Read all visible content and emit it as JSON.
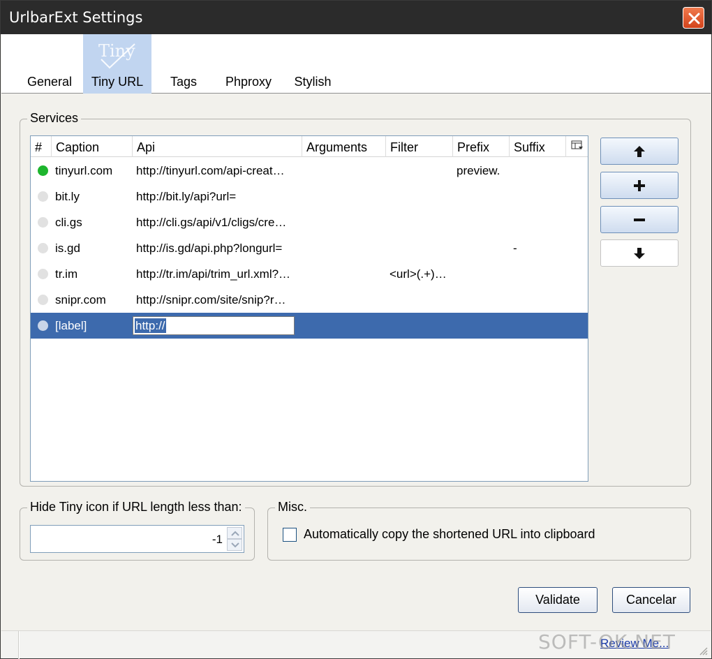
{
  "window": {
    "title": "UrlbarExt Settings"
  },
  "tabs": [
    {
      "label": "General",
      "selected": false
    },
    {
      "label": "Tiny URL",
      "selected": true
    },
    {
      "label": "Tags",
      "selected": false
    },
    {
      "label": "Phproxy",
      "selected": false
    },
    {
      "label": "Stylish",
      "selected": false
    }
  ],
  "tiny_logo_text": "Tiny",
  "services": {
    "legend": "Services",
    "columns": [
      "#",
      "Caption",
      "Api",
      "Arguments",
      "Filter",
      "Prefix",
      "Suffix"
    ],
    "rows": [
      {
        "active": true,
        "caption": "tinyurl.com",
        "api": "http://tinyurl.com/api-creat…",
        "arguments": "",
        "filter": "",
        "prefix": "preview.",
        "suffix": ""
      },
      {
        "active": false,
        "caption": "bit.ly",
        "api": "http://bit.ly/api?url=",
        "arguments": "",
        "filter": "",
        "prefix": "",
        "suffix": ""
      },
      {
        "active": false,
        "caption": "cli.gs",
        "api": "http://cli.gs/api/v1/cligs/cre…",
        "arguments": "",
        "filter": "",
        "prefix": "",
        "suffix": ""
      },
      {
        "active": false,
        "caption": "is.gd",
        "api": "http://is.gd/api.php?longurl=",
        "arguments": "",
        "filter": "",
        "prefix": "",
        "suffix": "-"
      },
      {
        "active": false,
        "caption": "tr.im",
        "api": "http://tr.im/api/trim_url.xml?…",
        "arguments": "",
        "filter": "<url>(.+)…",
        "prefix": "",
        "suffix": ""
      },
      {
        "active": false,
        "caption": "snipr.com",
        "api": "http://snipr.com/site/snip?r…",
        "arguments": "",
        "filter": "",
        "prefix": "",
        "suffix": ""
      }
    ],
    "editing_row": {
      "caption": "[label]",
      "api_edit_value": "http://"
    }
  },
  "hide_tiny": {
    "legend": "Hide Tiny icon if URL length less than:",
    "value": "-1"
  },
  "misc": {
    "legend": "Misc.",
    "auto_copy_label": "Automatically copy the shortened URL into clipboard",
    "auto_copy_checked": false
  },
  "buttons": {
    "validate": "Validate",
    "cancel": "Cancelar"
  },
  "status": {
    "review_link": "Review Me..."
  },
  "watermark": "SOFT-OK.NET",
  "colors": {
    "titlebar": "#2b2b2b",
    "selection": "#3d6aad",
    "active_dot": "#1db52d",
    "close": "#d2431b"
  }
}
